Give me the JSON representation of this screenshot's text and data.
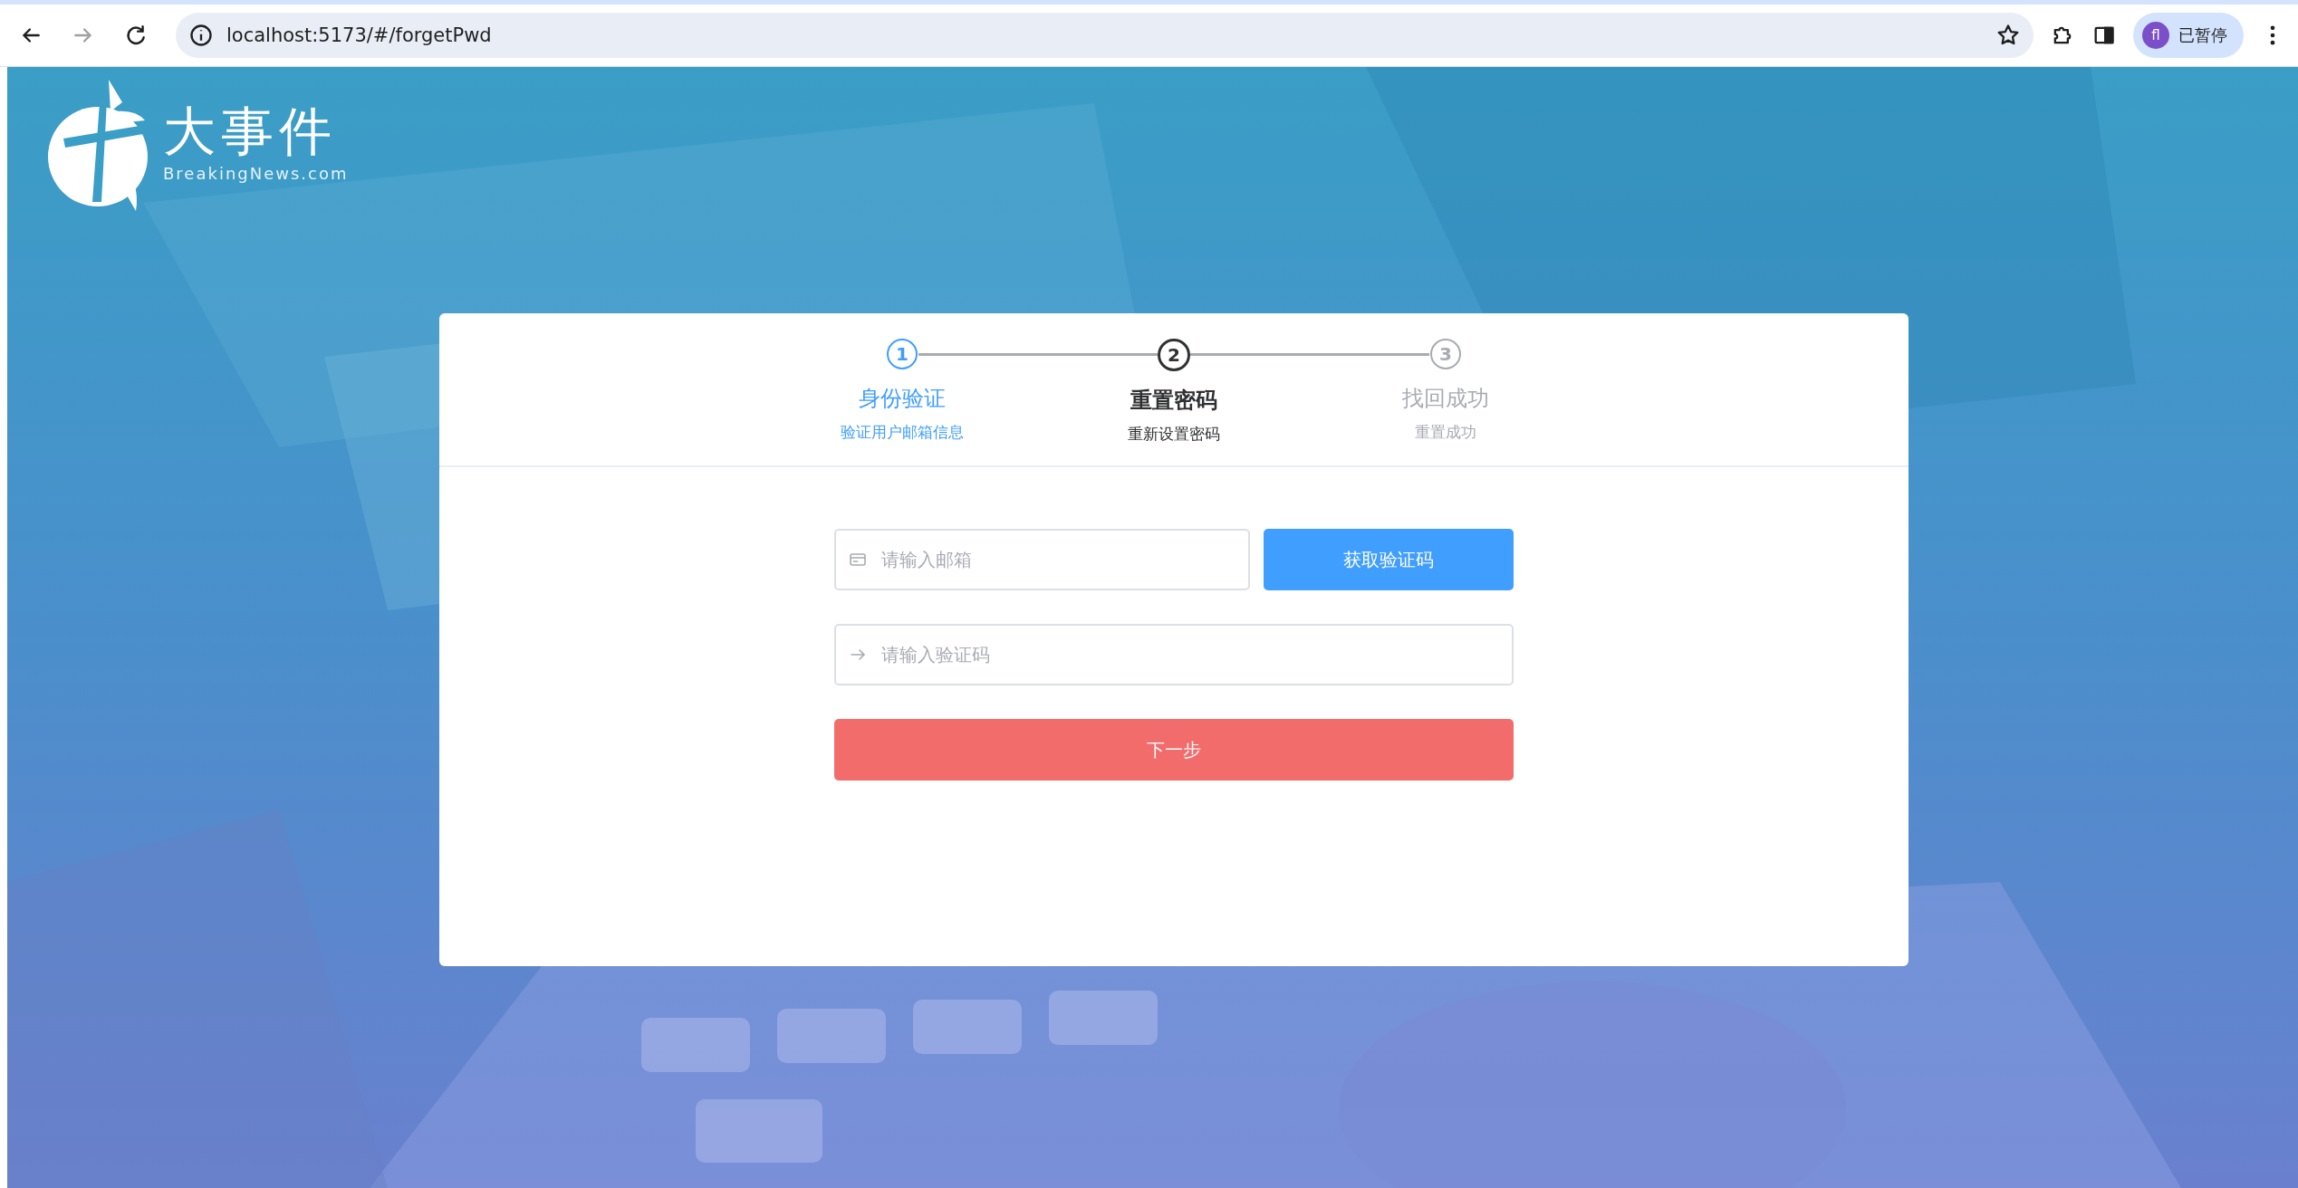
{
  "browser": {
    "back_disabled": false,
    "forward_disabled": true,
    "url": "localhost:5173/#/forgetPwd",
    "profile": {
      "initials": "fl",
      "label": "已暂停"
    }
  },
  "logo": {
    "title": "大事件",
    "subtitle": "BreakingNews.com"
  },
  "steps": [
    {
      "number": "1",
      "title": "身份验证",
      "description": "验证用户邮箱信息",
      "done": true,
      "selected": false
    },
    {
      "number": "2",
      "title": "重置密码",
      "description": "重新设置密码",
      "done": false,
      "selected": true
    },
    {
      "number": "3",
      "title": "找回成功",
      "description": "重置成功",
      "done": false,
      "selected": false
    }
  ],
  "form": {
    "email": {
      "placeholder": "请输入邮箱"
    },
    "send_code_button": "获取验证码",
    "code": {
      "placeholder": "请输入验证码"
    },
    "next_button": "下一步"
  }
}
